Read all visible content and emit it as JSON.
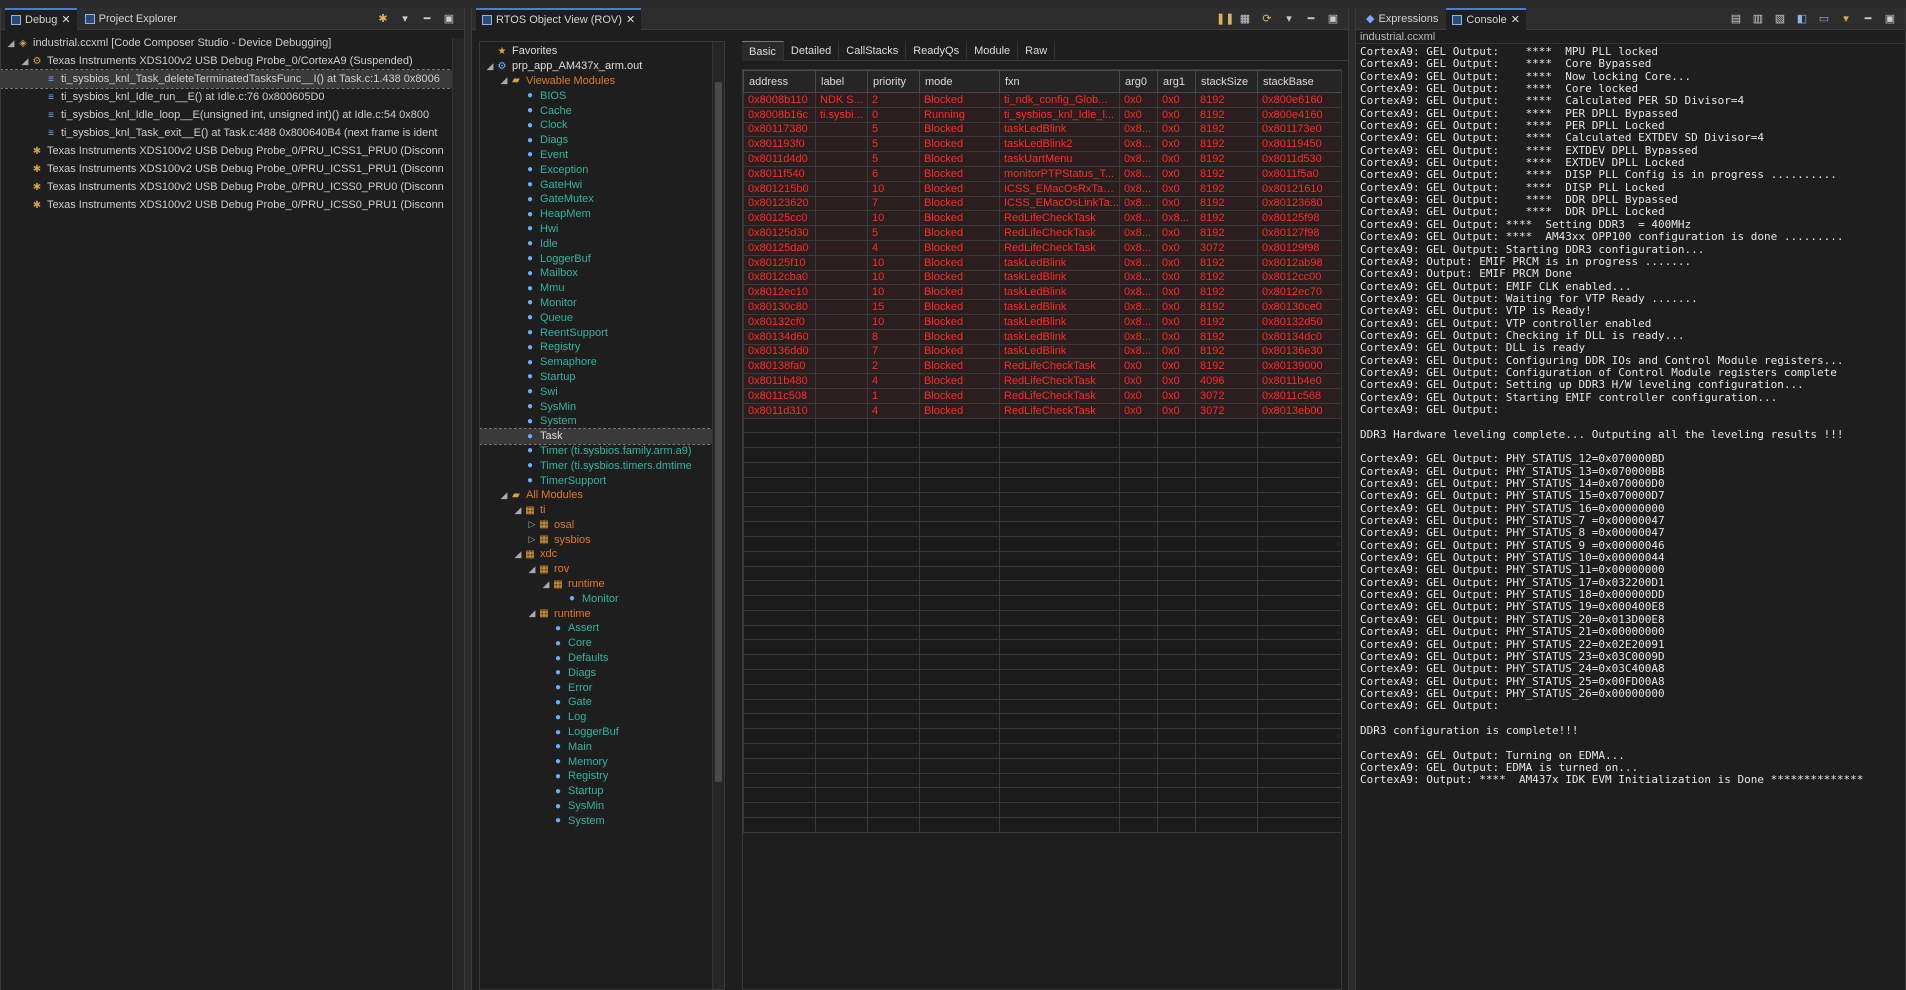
{
  "debug": {
    "tabs": [
      "Debug",
      "Project Explorer"
    ],
    "tree": [
      {
        "label": "industrial.ccxml [Code Composer Studio - Device Debugging]",
        "level": 0,
        "icon": "target-config-icon",
        "toggle": "◢"
      },
      {
        "label": "Texas Instruments XDS100v2 USB Debug Probe_0/CortexA9 (Suspended)",
        "level": 1,
        "icon": "suspended-thread-icon",
        "toggle": "◢"
      },
      {
        "label": "ti_sysbios_knl_Task_deleteTerminatedTasksFunc__I() at Task.c:1.438 0x8006",
        "level": 2,
        "icon": "stack-frame-icon",
        "toggle": "",
        "selected": true
      },
      {
        "label": "ti_sysbios_knl_Idle_run__E() at Idle.c:76 0x800605D0",
        "level": 2,
        "icon": "stack-frame-icon",
        "toggle": ""
      },
      {
        "label": "ti_sysbios_knl_Idle_loop__E(unsigned int, unsigned int)() at Idle.c:54 0x800",
        "level": 2,
        "icon": "stack-frame-icon",
        "toggle": ""
      },
      {
        "label": "ti_sysbios_knl_Task_exit__E() at Task.c:488 0x800640B4  (next frame is ident",
        "level": 2,
        "icon": "stack-frame-icon",
        "toggle": ""
      },
      {
        "label": "Texas Instruments XDS100v2 USB Debug Probe_0/PRU_ICSS1_PRU0 (Disconn",
        "level": 1,
        "icon": "disconnected-icon",
        "toggle": ""
      },
      {
        "label": "Texas Instruments XDS100v2 USB Debug Probe_0/PRU_ICSS1_PRU1 (Disconn",
        "level": 1,
        "icon": "disconnected-icon",
        "toggle": ""
      },
      {
        "label": "Texas Instruments XDS100v2 USB Debug Probe_0/PRU_ICSS0_PRU0 (Disconn",
        "level": 1,
        "icon": "disconnected-icon",
        "toggle": ""
      },
      {
        "label": "Texas Instruments XDS100v2 USB Debug Probe_0/PRU_ICSS0_PRU1 (Disconn",
        "level": 1,
        "icon": "disconnected-icon",
        "toggle": ""
      }
    ]
  },
  "rov": {
    "tab": "RTOS Object View (ROV)",
    "modules": [
      {
        "label": "Favorites",
        "level": 0,
        "color": "white",
        "icon": "star-icon",
        "toggle": ""
      },
      {
        "label": "prp_app_AM437x_arm.out",
        "level": 0,
        "color": "white",
        "icon": "program-icon",
        "toggle": "◢"
      },
      {
        "label": "Viewable Modules",
        "level": 1,
        "color": "orange",
        "icon": "folder-icon",
        "toggle": "◢"
      },
      {
        "label": "BIOS",
        "level": 2,
        "color": "teal",
        "icon": "module-icon",
        "toggle": ""
      },
      {
        "label": "Cache",
        "level": 2,
        "color": "teal",
        "icon": "module-icon",
        "toggle": ""
      },
      {
        "label": "Clock",
        "level": 2,
        "color": "teal",
        "icon": "module-icon",
        "toggle": ""
      },
      {
        "label": "Diags",
        "level": 2,
        "color": "teal",
        "icon": "module-icon",
        "toggle": ""
      },
      {
        "label": "Event",
        "level": 2,
        "color": "teal",
        "icon": "module-icon",
        "toggle": ""
      },
      {
        "label": "Exception",
        "level": 2,
        "color": "teal",
        "icon": "module-icon",
        "toggle": ""
      },
      {
        "label": "GateHwi",
        "level": 2,
        "color": "teal",
        "icon": "module-icon",
        "toggle": ""
      },
      {
        "label": "GateMutex",
        "level": 2,
        "color": "teal",
        "icon": "module-icon",
        "toggle": ""
      },
      {
        "label": "HeapMem",
        "level": 2,
        "color": "teal",
        "icon": "module-icon",
        "toggle": ""
      },
      {
        "label": "Hwi",
        "level": 2,
        "color": "teal",
        "icon": "module-icon",
        "toggle": ""
      },
      {
        "label": "Idle",
        "level": 2,
        "color": "teal",
        "icon": "module-icon",
        "toggle": ""
      },
      {
        "label": "LoggerBuf",
        "level": 2,
        "color": "teal",
        "icon": "module-icon",
        "toggle": ""
      },
      {
        "label": "Mailbox",
        "level": 2,
        "color": "teal",
        "icon": "module-icon",
        "toggle": ""
      },
      {
        "label": "Mmu",
        "level": 2,
        "color": "teal",
        "icon": "module-icon",
        "toggle": ""
      },
      {
        "label": "Monitor",
        "level": 2,
        "color": "teal",
        "icon": "module-icon",
        "toggle": ""
      },
      {
        "label": "Queue",
        "level": 2,
        "color": "teal",
        "icon": "module-icon",
        "toggle": ""
      },
      {
        "label": "ReentSupport",
        "level": 2,
        "color": "teal",
        "icon": "module-icon",
        "toggle": ""
      },
      {
        "label": "Registry",
        "level": 2,
        "color": "teal",
        "icon": "module-icon",
        "toggle": ""
      },
      {
        "label": "Semaphore",
        "level": 2,
        "color": "teal",
        "icon": "module-icon",
        "toggle": ""
      },
      {
        "label": "Startup",
        "level": 2,
        "color": "teal",
        "icon": "module-icon",
        "toggle": ""
      },
      {
        "label": "Swi",
        "level": 2,
        "color": "teal",
        "icon": "module-icon",
        "toggle": ""
      },
      {
        "label": "SysMin",
        "level": 2,
        "color": "teal",
        "icon": "module-icon",
        "toggle": ""
      },
      {
        "label": "System",
        "level": 2,
        "color": "teal",
        "icon": "module-icon",
        "toggle": ""
      },
      {
        "label": "Task",
        "level": 2,
        "color": "white",
        "icon": "module-icon",
        "toggle": "",
        "selected": true
      },
      {
        "label": "Timer (ti.sysbios.family.arm.a9)",
        "level": 2,
        "color": "teal",
        "icon": "module-icon",
        "toggle": ""
      },
      {
        "label": "Timer (ti.sysbios.timers.dmtime",
        "level": 2,
        "color": "teal",
        "icon": "module-icon",
        "toggle": ""
      },
      {
        "label": "TimerSupport",
        "level": 2,
        "color": "teal",
        "icon": "module-icon",
        "toggle": ""
      },
      {
        "label": "All Modules",
        "level": 1,
        "color": "orange",
        "icon": "folder-icon",
        "toggle": "◢"
      },
      {
        "label": "ti",
        "level": 2,
        "color": "orange",
        "icon": "package-icon",
        "toggle": "◢"
      },
      {
        "label": "osal",
        "level": 3,
        "color": "orange",
        "icon": "package-icon",
        "toggle": "▷"
      },
      {
        "label": "sysbios",
        "level": 3,
        "color": "orange",
        "icon": "package-icon",
        "toggle": "▷"
      },
      {
        "label": "xdc",
        "level": 2,
        "color": "orange",
        "icon": "package-icon",
        "toggle": "◢"
      },
      {
        "label": "rov",
        "level": 3,
        "color": "orange",
        "icon": "package-icon",
        "toggle": "◢"
      },
      {
        "label": "runtime",
        "level": 4,
        "color": "orange",
        "icon": "package-icon",
        "toggle": "◢"
      },
      {
        "label": "Monitor",
        "level": 5,
        "color": "teal",
        "icon": "module-icon",
        "toggle": ""
      },
      {
        "label": "runtime",
        "level": 3,
        "color": "orange",
        "icon": "package-icon",
        "toggle": "◢"
      },
      {
        "label": "Assert",
        "level": 4,
        "color": "teal",
        "icon": "module-icon",
        "toggle": ""
      },
      {
        "label": "Core",
        "level": 4,
        "color": "teal",
        "icon": "module-icon",
        "toggle": ""
      },
      {
        "label": "Defaults",
        "level": 4,
        "color": "teal",
        "icon": "module-icon",
        "toggle": ""
      },
      {
        "label": "Diags",
        "level": 4,
        "color": "teal",
        "icon": "module-icon",
        "toggle": ""
      },
      {
        "label": "Error",
        "level": 4,
        "color": "teal",
        "icon": "module-icon",
        "toggle": ""
      },
      {
        "label": "Gate",
        "level": 4,
        "color": "teal",
        "icon": "module-icon",
        "toggle": ""
      },
      {
        "label": "Log",
        "level": 4,
        "color": "teal",
        "icon": "module-icon",
        "toggle": ""
      },
      {
        "label": "LoggerBuf",
        "level": 4,
        "color": "teal",
        "icon": "module-icon",
        "toggle": ""
      },
      {
        "label": "Main",
        "level": 4,
        "color": "teal",
        "icon": "module-icon",
        "toggle": ""
      },
      {
        "label": "Memory",
        "level": 4,
        "color": "teal",
        "icon": "module-icon",
        "toggle": ""
      },
      {
        "label": "Registry",
        "level": 4,
        "color": "teal",
        "icon": "module-icon",
        "toggle": ""
      },
      {
        "label": "Startup",
        "level": 4,
        "color": "teal",
        "icon": "module-icon",
        "toggle": ""
      },
      {
        "label": "SysMin",
        "level": 4,
        "color": "teal",
        "icon": "module-icon",
        "toggle": ""
      },
      {
        "label": "System",
        "level": 4,
        "color": "teal",
        "icon": "module-icon",
        "toggle": ""
      }
    ],
    "subtabs": [
      "Basic",
      "Detailed",
      "CallStacks",
      "ReadyQs",
      "Module",
      "Raw"
    ],
    "columns": [
      "address",
      "label",
      "priority",
      "mode",
      "fxn",
      "arg0",
      "arg1",
      "stackSize",
      "stackBase"
    ],
    "rows": [
      [
        "0x8008b110",
        "NDK S...",
        "2",
        "Blocked",
        "ti_ndk_config_Glob...",
        "0x0",
        "0x0",
        "8192",
        "0x800e6160"
      ],
      [
        "0x8008b16c",
        "ti.sysbi...",
        "0",
        "Running",
        "ti_sysbios_knl_Idle_l...",
        "0x0",
        "0x0",
        "8192",
        "0x800e4160"
      ],
      [
        "0x80117380",
        "",
        "5",
        "Blocked",
        "taskLedBlink",
        "0x8...",
        "0x0",
        "8192",
        "0x801173e0"
      ],
      [
        "0x801193f0",
        "",
        "5",
        "Blocked",
        "taskLedBlink2",
        "0x8...",
        "0x0",
        "8192",
        "0x80119450"
      ],
      [
        "0x8011d4d0",
        "",
        "5",
        "Blocked",
        "taskUartMenu",
        "0x8...",
        "0x0",
        "8192",
        "0x8011d530"
      ],
      [
        "0x8011f540",
        "",
        "6",
        "Blocked",
        "monitorPTPStatus_T...",
        "0x8...",
        "0x0",
        "8192",
        "0x8011f5a0"
      ],
      [
        "0x801215b0",
        "",
        "10",
        "Blocked",
        "ICSS_EMacOsRxTask...",
        "0x8...",
        "0x0",
        "8192",
        "0x80121610"
      ],
      [
        "0x80123620",
        "",
        "7",
        "Blocked",
        "ICSS_EMacOsLinkTa...",
        "0x8...",
        "0x0",
        "8192",
        "0x80123680"
      ],
      [
        "0x80125cc0",
        "",
        "10",
        "Blocked",
        "RedLifeCheckTask",
        "0x8...",
        "0x8...",
        "8192",
        "0x80125f98"
      ],
      [
        "0x80125d30",
        "",
        "5",
        "Blocked",
        "RedLifeCheckTask",
        "0x8...",
        "0x0",
        "8192",
        "0x80127f98"
      ],
      [
        "0x80125da0",
        "",
        "4",
        "Blocked",
        "RedLifeCheckTask",
        "0x8...",
        "0x0",
        "3072",
        "0x80129f98"
      ],
      [
        "0x80125f10",
        "",
        "10",
        "Blocked",
        "taskLedBlink",
        "0x8...",
        "0x0",
        "8192",
        "0x8012ab98"
      ],
      [
        "0x8012cba0",
        "",
        "10",
        "Blocked",
        "taskLedBlink",
        "0x8...",
        "0x0",
        "8192",
        "0x8012cc00"
      ],
      [
        "0x8012ec10",
        "",
        "10",
        "Blocked",
        "taskLedBlink",
        "0x8...",
        "0x0",
        "8192",
        "0x8012ec70"
      ],
      [
        "0x80130c80",
        "",
        "15",
        "Blocked",
        "taskLedBlink",
        "0x8...",
        "0x0",
        "8192",
        "0x80130ce0"
      ],
      [
        "0x80132cf0",
        "",
        "10",
        "Blocked",
        "taskLedBlink",
        "0x8...",
        "0x0",
        "8192",
        "0x80132d50"
      ],
      [
        "0x80134d60",
        "",
        "8",
        "Blocked",
        "taskLedBlink",
        "0x8...",
        "0x0",
        "8192",
        "0x80134dc0"
      ],
      [
        "0x80136dd0",
        "",
        "7",
        "Blocked",
        "taskLedBlink",
        "0x8...",
        "0x0",
        "8192",
        "0x80136e30"
      ],
      [
        "0x80138fa0",
        "",
        "2",
        "Blocked",
        "RedLifeCheckTask",
        "0x0",
        "0x0",
        "8192",
        "0x80139000"
      ],
      [
        "0x8011b480",
        "",
        "4",
        "Blocked",
        "RedLifeCheckTask",
        "0x0",
        "0x0",
        "4096",
        "0x8011b4e0"
      ],
      [
        "0x8011c508",
        "",
        "1",
        "Blocked",
        "RedLifeCheckTask",
        "0x0",
        "0x0",
        "3072",
        "0x8011c568"
      ],
      [
        "0x8011d310",
        "",
        "4",
        "Blocked",
        "RedLifeCheckTask",
        "0x0",
        "0x0",
        "3072",
        "0x8013eb00"
      ]
    ]
  },
  "console": {
    "tabs": [
      "Expressions",
      "Console"
    ],
    "title": "industrial.ccxml",
    "lines": [
      "CortexA9: GEL Output:    ****  MPU PLL locked",
      "CortexA9: GEL Output:    ****  Core Bypassed",
      "CortexA9: GEL Output:    ****  Now locking Core...",
      "CortexA9: GEL Output:    ****  Core locked",
      "CortexA9: GEL Output:    ****  Calculated PER SD Divisor=4",
      "CortexA9: GEL Output:    ****  PER DPLL Bypassed",
      "CortexA9: GEL Output:    ****  PER DPLL Locked",
      "CortexA9: GEL Output:    ****  Calculated EXTDEV SD Divisor=4",
      "CortexA9: GEL Output:    ****  EXTDEV DPLL Bypassed",
      "CortexA9: GEL Output:    ****  EXTDEV DPLL Locked",
      "CortexA9: GEL Output:    ****  DISP PLL Config is in progress ..........",
      "CortexA9: GEL Output:    ****  DISP PLL Locked",
      "CortexA9: GEL Output:    ****  DDR DPLL Bypassed",
      "CortexA9: GEL Output:    ****  DDR DPLL Locked",
      "CortexA9: GEL Output: ****  Setting DDR3  = 400MHz",
      "CortexA9: GEL Output: ****  AM43xx OPP100 configuration is done .........",
      "CortexA9: GEL Output: Starting DDR3 configuration...",
      "CortexA9: Output: EMIF PRCM is in progress .......",
      "CortexA9: Output: EMIF PRCM Done",
      "CortexA9: GEL Output: EMIF CLK enabled...",
      "CortexA9: GEL Output: Waiting for VTP Ready .......",
      "CortexA9: GEL Output: VTP is Ready!",
      "CortexA9: GEL Output: VTP controller enabled",
      "CortexA9: GEL Output: Checking if DLL is ready...",
      "CortexA9: GEL Output: DLL is ready",
      "CortexA9: GEL Output: Configuring DDR IOs and Control Module registers...",
      "CortexA9: GEL Output: Configuration of Control Module registers complete",
      "CortexA9: GEL Output: Setting up DDR3 H/W leveling configuration...",
      "CortexA9: GEL Output: Starting EMIF controller configuration...",
      "CortexA9: GEL Output:",
      "",
      "DDR3 Hardware leveling complete... Outputing all the leveling results !!!",
      "",
      "CortexA9: GEL Output: PHY_STATUS_12=0x070000BD",
      "CortexA9: GEL Output: PHY_STATUS_13=0x070000BB",
      "CortexA9: GEL Output: PHY_STATUS_14=0x070000D0",
      "CortexA9: GEL Output: PHY_STATUS_15=0x070000D7",
      "CortexA9: GEL Output: PHY_STATUS_16=0x00000000",
      "CortexA9: GEL Output: PHY_STATUS_7 =0x00000047",
      "CortexA9: GEL Output: PHY_STATUS_8 =0x00000047",
      "CortexA9: GEL Output: PHY_STATUS_9 =0x00000046",
      "CortexA9: GEL Output: PHY_STATUS_10=0x00000044",
      "CortexA9: GEL Output: PHY_STATUS_11=0x00000000",
      "CortexA9: GEL Output: PHY_STATUS_17=0x032200D1",
      "CortexA9: GEL Output: PHY_STATUS_18=0x000000DD",
      "CortexA9: GEL Output: PHY_STATUS_19=0x000400E8",
      "CortexA9: GEL Output: PHY_STATUS_20=0x013D00E8",
      "CortexA9: GEL Output: PHY_STATUS_21=0x00000000",
      "CortexA9: GEL Output: PHY_STATUS_22=0x02E20091",
      "CortexA9: GEL Output: PHY_STATUS_23=0x03C0009D",
      "CortexA9: GEL Output: PHY_STATUS_24=0x03C400A8",
      "CortexA9: GEL Output: PHY_STATUS_25=0x00FD00A8",
      "CortexA9: GEL Output: PHY_STATUS_26=0x00000000",
      "CortexA9: GEL Output:",
      "",
      "DDR3 configuration is complete!!!",
      "",
      "CortexA9: GEL Output: Turning on EDMA...",
      "CortexA9: GEL Output: EDMA is turned on...",
      "CortexA9: Output: ****  AM437x IDK EVM Initialization is Done **************"
    ]
  },
  "colors": {
    "accent": "#4a7fd0",
    "error_text": "#ff2a2a",
    "module_teal": "#2fb5a0",
    "folder_orange": "#e07a22"
  }
}
